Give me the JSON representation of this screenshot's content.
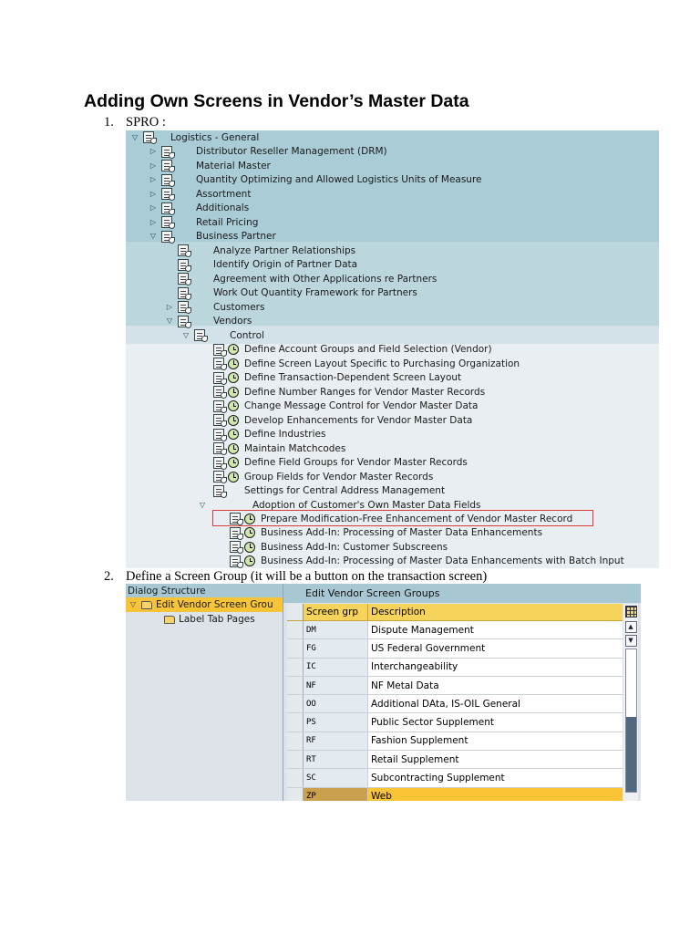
{
  "title": "Adding Own Screens in Vendor’s Master Data",
  "steps": [
    {
      "num": "1.",
      "text": "SPRO :"
    },
    {
      "num": "2.",
      "text": "Define a Screen Group (it will be a button on the transaction screen)"
    }
  ],
  "spro_tree": {
    "root": "Logistics - General",
    "level1": [
      "Distributor Reseller Management (DRM)",
      "Material Master",
      "Quantity Optimizing and Allowed Logistics Units of Measure",
      "Assortment",
      "Additionals",
      "Retail Pricing",
      "Business Partner"
    ],
    "business_partner_children": [
      "Analyze Partner Relationships",
      "Identify Origin of Partner Data",
      "Agreement with Other Applications re Partners",
      "Work Out Quantity Framework for Partners",
      "Customers",
      "Vendors"
    ],
    "control": "Control",
    "control_items": [
      "Define Account Groups and Field Selection (Vendor)",
      "Define Screen Layout Specific to Purchasing Organization",
      "Define Transaction-Dependent Screen Layout",
      "Define Number Ranges for Vendor Master Records",
      "Change Message Control for Vendor Master Data",
      "Develop Enhancements for Vendor Master Data",
      "Define Industries",
      "Maintain Matchcodes",
      "Define Field Groups for Vendor Master Records",
      "Group Fields for Vendor Master Records",
      "Settings for Central Address Management",
      "Adoption of Customer's Own Master Data Fields"
    ],
    "adoption_items": [
      "Prepare Modification-Free Enhancement of Vendor Master Record",
      "Business Add-In: Processing of Master Data Enhancements",
      "Business Add-In: Customer Subscreens",
      "Business Add-In: Processing of Master Data Enhancements with Batch Input"
    ]
  },
  "dialog": {
    "header": "Dialog Structure",
    "items": [
      "Edit Vendor Screen Grou",
      "Label Tab Pages"
    ]
  },
  "table": {
    "title": "Edit Vendor Screen Groups",
    "columns": [
      "Screen grp",
      "Description"
    ],
    "rows": [
      {
        "code": "DM",
        "desc": "Dispute Management"
      },
      {
        "code": "FG",
        "desc": "US Federal Government"
      },
      {
        "code": "IC",
        "desc": "Interchangeability"
      },
      {
        "code": "NF",
        "desc": "NF Metal Data"
      },
      {
        "code": "OO",
        "desc": "Additional DAta, IS-OIL General"
      },
      {
        "code": "PS",
        "desc": "Public Sector Supplement"
      },
      {
        "code": "RF",
        "desc": "Fashion Supplement"
      },
      {
        "code": "RT",
        "desc": "Retail Supplement"
      },
      {
        "code": "SC",
        "desc": "Subcontracting Supplement"
      },
      {
        "code": "ZP",
        "desc": "Web"
      }
    ]
  },
  "colors": {
    "highlight_border": "#d93a3a",
    "selected_row": "#f9c436",
    "tree_header_band": "#a9ccd6"
  }
}
